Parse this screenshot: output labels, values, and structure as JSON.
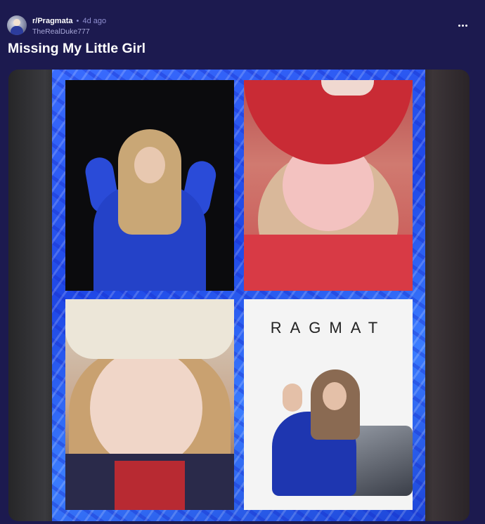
{
  "post": {
    "subreddit": "r/Pragmata",
    "separator": "•",
    "time": "4d ago",
    "author": "TheRealDuke777",
    "title": "Missing My Little Girl",
    "more_icon": "more-horizontal-icon"
  },
  "media": {
    "tile4_logo": "RAGMAT"
  }
}
